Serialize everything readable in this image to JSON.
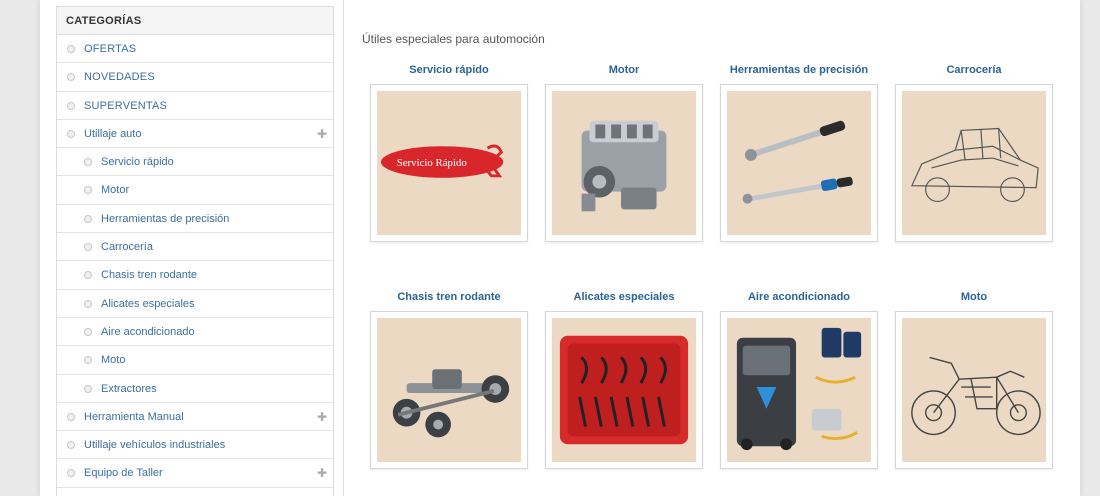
{
  "sidebar": {
    "title": "CATEGORÍAS",
    "items": [
      {
        "label": "OFERTAS",
        "level": 0,
        "expandable": false
      },
      {
        "label": "NOVEDADES",
        "level": 0,
        "expandable": false
      },
      {
        "label": "SUPERVENTAS",
        "level": 0,
        "expandable": false
      },
      {
        "label": "Utillaje auto",
        "level": 0,
        "expandable": true
      },
      {
        "label": "Servicio rápido",
        "level": 1,
        "expandable": false
      },
      {
        "label": "Motor",
        "level": 1,
        "expandable": false
      },
      {
        "label": "Herramientas de precisión",
        "level": 1,
        "expandable": false
      },
      {
        "label": "Carrocería",
        "level": 1,
        "expandable": false
      },
      {
        "label": "Chasis tren rodante",
        "level": 1,
        "expandable": false
      },
      {
        "label": "Alicates especiales",
        "level": 1,
        "expandable": false
      },
      {
        "label": "Aire acondicionado",
        "level": 1,
        "expandable": false
      },
      {
        "label": "Moto",
        "level": 1,
        "expandable": false
      },
      {
        "label": "Extractores",
        "level": 1,
        "expandable": false
      },
      {
        "label": "Herramienta Manual",
        "level": 0,
        "expandable": true
      },
      {
        "label": "Utillaje vehículos industriales",
        "level": 0,
        "expandable": false
      },
      {
        "label": "Equipo de Taller",
        "level": 0,
        "expandable": true
      }
    ]
  },
  "main": {
    "intro": "Útiles especiales para automoción",
    "categories": [
      {
        "title": "Servicio rápido",
        "icon": "servicio-rapido-logo-icon",
        "logo_text": "Servicio Rápido"
      },
      {
        "title": "Motor",
        "icon": "engine-icon"
      },
      {
        "title": "Herramientas de precisión",
        "icon": "torque-wrench-icon"
      },
      {
        "title": "Carrocería",
        "icon": "car-body-icon"
      },
      {
        "title": "Chasis tren rodante",
        "icon": "chassis-icon"
      },
      {
        "title": "Alicates especiales",
        "icon": "pliers-case-icon"
      },
      {
        "title": "Aire acondicionado",
        "icon": "ac-machine-icon"
      },
      {
        "title": "Moto",
        "icon": "motorcycle-icon"
      }
    ]
  },
  "colors": {
    "link": "#2a6496",
    "sidebar_link": "#3a6fa0",
    "thumb_bg": "#ecd9c4",
    "logo_red": "#d8262b"
  }
}
